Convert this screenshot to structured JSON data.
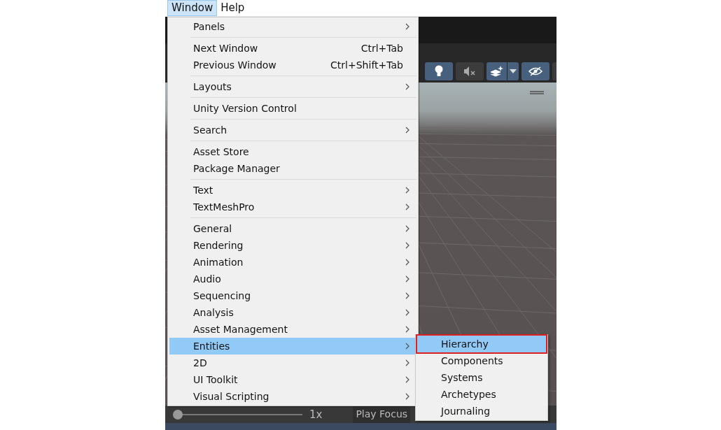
{
  "menubar": [
    {
      "label": "Window",
      "selected": true
    },
    {
      "label": "Help",
      "selected": false
    }
  ],
  "menu": {
    "groups": [
      {
        "items": [
          {
            "label": "Panels",
            "has_submenu": true,
            "selected": false
          }
        ]
      },
      {
        "items": [
          {
            "label": "Next Window",
            "shortcut": "Ctrl+Tab",
            "has_submenu": false,
            "selected": false
          },
          {
            "label": "Previous Window",
            "shortcut": "Ctrl+Shift+Tab",
            "has_submenu": false,
            "selected": false
          }
        ]
      },
      {
        "items": [
          {
            "label": "Layouts",
            "has_submenu": true,
            "selected": false
          }
        ]
      },
      {
        "items": [
          {
            "label": "Unity Version Control",
            "has_submenu": false,
            "selected": false
          }
        ]
      },
      {
        "items": [
          {
            "label": "Search",
            "has_submenu": true,
            "selected": false
          }
        ]
      },
      {
        "items": [
          {
            "label": "Asset Store",
            "has_submenu": false,
            "selected": false
          },
          {
            "label": "Package Manager",
            "has_submenu": false,
            "selected": false
          }
        ]
      },
      {
        "items": [
          {
            "label": "Text",
            "has_submenu": true,
            "selected": false
          },
          {
            "label": "TextMeshPro",
            "has_submenu": true,
            "selected": false
          }
        ]
      },
      {
        "items": [
          {
            "label": "General",
            "has_submenu": true,
            "selected": false
          },
          {
            "label": "Rendering",
            "has_submenu": true,
            "selected": false
          },
          {
            "label": "Animation",
            "has_submenu": true,
            "selected": false
          },
          {
            "label": "Audio",
            "has_submenu": true,
            "selected": false
          },
          {
            "label": "Sequencing",
            "has_submenu": true,
            "selected": false
          },
          {
            "label": "Analysis",
            "has_submenu": true,
            "selected": false
          },
          {
            "label": "Asset Management",
            "has_submenu": true,
            "selected": false
          },
          {
            "label": "Entities",
            "has_submenu": true,
            "selected": true
          },
          {
            "label": "2D",
            "has_submenu": true,
            "selected": false
          },
          {
            "label": "UI Toolkit",
            "has_submenu": true,
            "selected": false
          },
          {
            "label": "Visual Scripting",
            "has_submenu": true,
            "selected": false
          }
        ]
      }
    ]
  },
  "submenu": {
    "items": [
      {
        "label": "Hierarchy",
        "selected": true,
        "outlined": true
      },
      {
        "label": "Components",
        "selected": false,
        "outlined": false
      },
      {
        "label": "Systems",
        "selected": false,
        "outlined": false
      },
      {
        "label": "Archetypes",
        "selected": false,
        "outlined": false
      },
      {
        "label": "Journaling",
        "selected": false,
        "outlined": false
      }
    ]
  },
  "toolbar": [
    {
      "kind": "lighting",
      "on": true
    },
    {
      "kind": "audio",
      "on": false
    },
    {
      "kind": "effects",
      "on": true
    },
    {
      "kind": "visibility",
      "on": true
    }
  ],
  "bottom_bar": {
    "slider": {
      "level": 0
    },
    "speed": "1x",
    "tab_label": "Play Focus"
  }
}
